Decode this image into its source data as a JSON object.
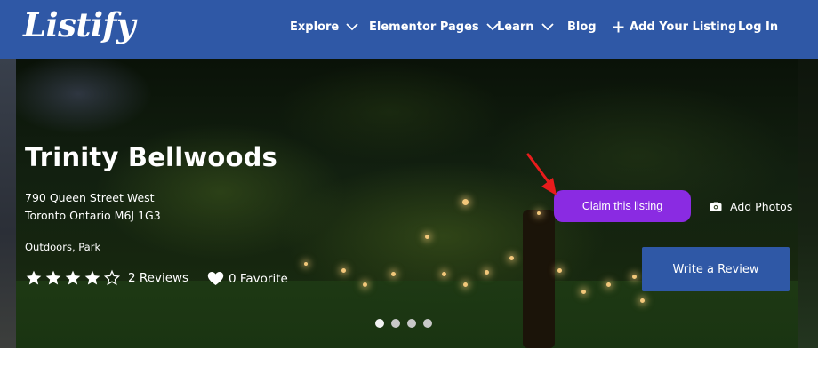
{
  "header": {
    "logo": "Listify",
    "nav": [
      {
        "label": "Explore"
      },
      {
        "label": "Elementor Pages"
      },
      {
        "label": "Learn"
      },
      {
        "label": "Blog"
      },
      {
        "label": "Add Your Listing"
      },
      {
        "label": "Log In"
      }
    ]
  },
  "listing": {
    "title": "Trinity Bellwoods",
    "address_line1": "790 Queen Street West",
    "address_line2": "Toronto Ontario M6J 1G3",
    "categories": "Outdoors, Park",
    "rating": 4,
    "rating_max": 5,
    "reviews": "2 Reviews",
    "favorites": "0 Favorite"
  },
  "actions": {
    "claim": "Claim this listing",
    "add_photos": "Add Photos",
    "write_review": "Write a Review"
  },
  "slider": {
    "count": 4,
    "active_index": 0
  },
  "colors": {
    "header_bg": "#2f58a6",
    "claim_bg": "#8a2be2",
    "review_bg": "#2f58a6",
    "annotation_arrow": "#e81c1c"
  },
  "icons": {
    "chevron": "chevron-down-icon",
    "plus": "plus-icon",
    "star": "star-icon",
    "heart": "heart-icon",
    "camera": "camera-icon"
  }
}
